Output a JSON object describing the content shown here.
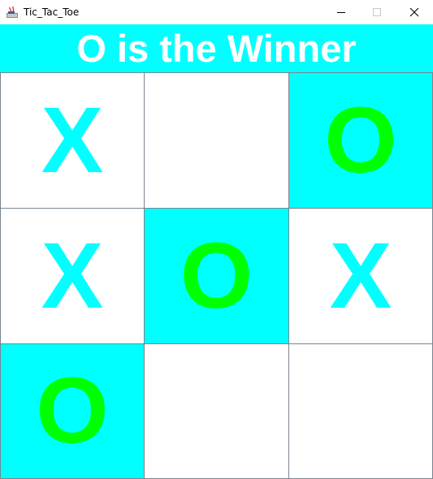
{
  "window": {
    "title": "Tic_Tac_Toe",
    "app_icon": "java-app-icon",
    "controls": {
      "minimize_icon": "minimize-icon",
      "maximize_icon": "maximize-icon",
      "close_icon": "close-icon"
    }
  },
  "banner": {
    "text": "O is the Winner",
    "background": "#00ffff",
    "text_color": "#ffffff"
  },
  "colors": {
    "x_mark": "#00ffff",
    "o_mark": "#00ff00",
    "winning_cell_bg": "#00ffff",
    "cell_bg": "#ffffff",
    "grid_line": "#7a8590"
  },
  "board": {
    "cells": [
      {
        "mark": "X",
        "winning": false
      },
      {
        "mark": "",
        "winning": false
      },
      {
        "mark": "O",
        "winning": true
      },
      {
        "mark": "X",
        "winning": false
      },
      {
        "mark": "O",
        "winning": true
      },
      {
        "mark": "X",
        "winning": false
      },
      {
        "mark": "O",
        "winning": true
      },
      {
        "mark": "",
        "winning": false
      },
      {
        "mark": "",
        "winning": false
      }
    ]
  }
}
